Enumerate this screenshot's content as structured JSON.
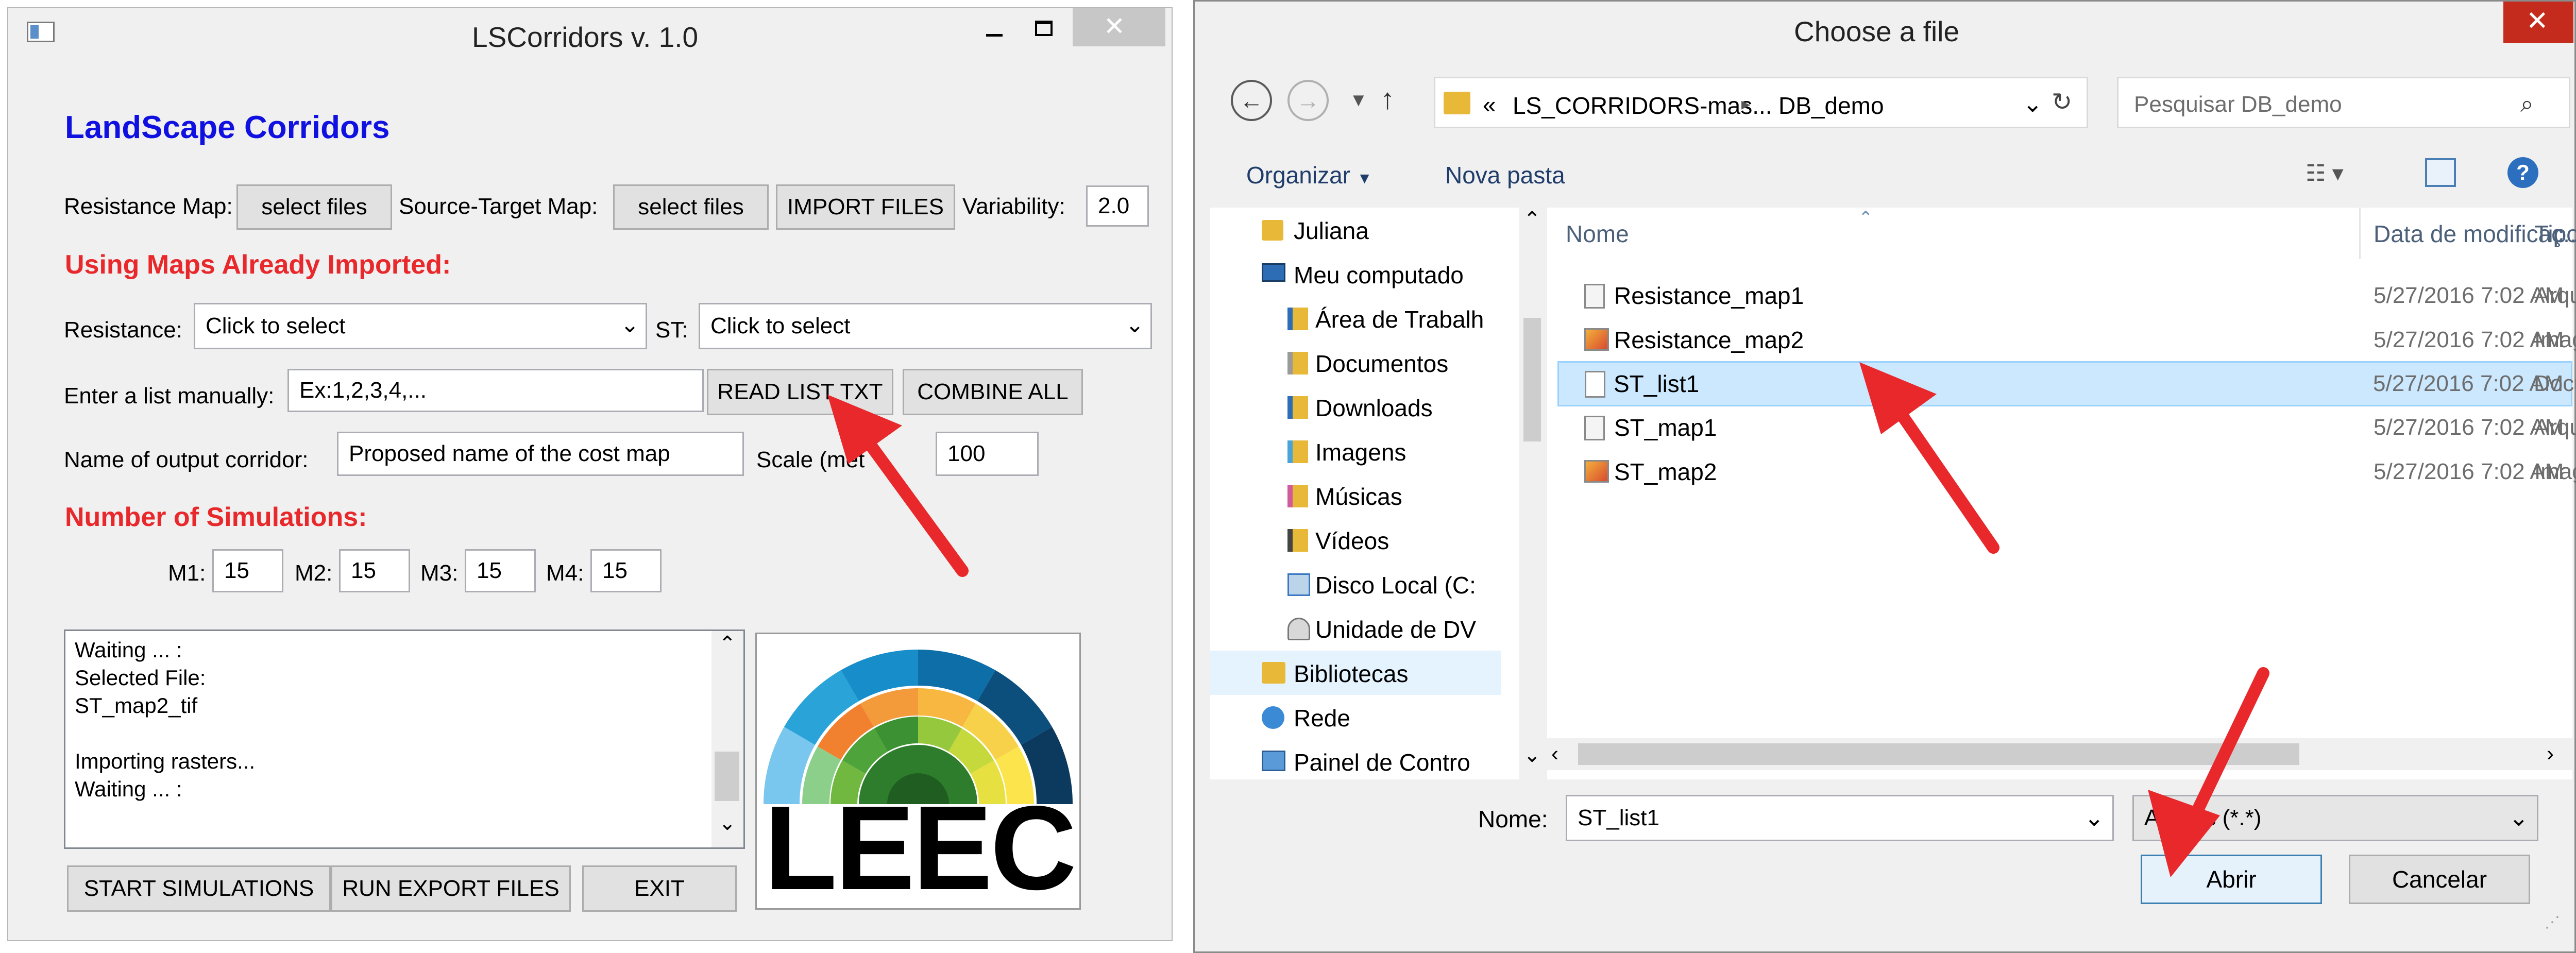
{
  "left_window": {
    "title": "LSCorridors v. 1.0",
    "heading": "LandScape Corridors",
    "resistance_map_label": "Resistance Map:",
    "select_files_1": "select files",
    "source_target_label": "Source-Target Map:",
    "select_files_2": "select files",
    "import_files": "IMPORT FILES",
    "variability_label": "Variability:",
    "variability_value": "2.0",
    "using_maps_heading": "Using Maps Already Imported:",
    "resistance_label": "Resistance:",
    "resistance_select": "Click to select",
    "st_label": "ST:",
    "st_select": "Click to select",
    "enter_list_label": "Enter a list manually:",
    "enter_list_value": "Ex:1,2,3,4,...",
    "read_list_txt": "READ LIST TXT",
    "combine_all": "COMBINE ALL",
    "output_name_label": "Name of output corridor:",
    "output_name_value": "Proposed name of the cost map",
    "scale_label": "Scale (met",
    "scale_value": "100",
    "num_sim_heading": "Number of Simulations:",
    "m1_label": "M1:",
    "m1_value": "15",
    "m2_label": "M2:",
    "m2_value": "15",
    "m3_label": "M3:",
    "m3_value": "15",
    "m4_label": "M4:",
    "m4_value": "15",
    "log_lines": [
      "Waiting ... :",
      "Selected File:",
      "ST_map2_tif",
      "",
      "Importing rasters...",
      "Waiting ... :"
    ],
    "logo_text": "LEEC",
    "start_simulations": "START SIMULATIONS",
    "run_export_files": "RUN EXPORT FILES",
    "exit": "EXIT"
  },
  "file_dialog": {
    "title": "Choose a file",
    "breadcrumb_chevrons": "«",
    "breadcrumb_1": "LS_CORRIDORS-mas...",
    "breadcrumb_sep": "▸",
    "breadcrumb_2": "DB_demo",
    "search_placeholder": "Pesquisar DB_demo",
    "organize": "Organizar",
    "new_folder": "Nova pasta",
    "nav_items": [
      {
        "label": "Juliana",
        "icon": "folder-icon"
      },
      {
        "label": "Meu computado",
        "icon": "computer-icon"
      },
      {
        "label": "Área de Trabalh",
        "icon": "folder-icon"
      },
      {
        "label": "Documentos",
        "icon": "folder-icon"
      },
      {
        "label": "Downloads",
        "icon": "folder-icon"
      },
      {
        "label": "Imagens",
        "icon": "folder-icon"
      },
      {
        "label": "Músicas",
        "icon": "folder-icon"
      },
      {
        "label": "Vídeos",
        "icon": "folder-icon"
      },
      {
        "label": "Disco Local (C:",
        "icon": "drive-icon"
      },
      {
        "label": "Unidade de DV",
        "icon": "drive-icon"
      },
      {
        "label": "Bibliotecas",
        "icon": "folder-icon"
      },
      {
        "label": "Rede",
        "icon": "network-icon"
      },
      {
        "label": "Painel de Contro",
        "icon": "control-panel-icon"
      }
    ],
    "columns": {
      "name": "Nome",
      "date": "Data de modificaç...",
      "type": "Tipo"
    },
    "files": [
      {
        "name": "Resistance_map1",
        "date": "5/27/2016 7:02 AM",
        "type": "Arquivo d",
        "icon": "file-icon"
      },
      {
        "name": "Resistance_map2",
        "date": "5/27/2016 7:02 AM",
        "type": "Imagem T",
        "icon": "image-icon"
      },
      {
        "name": "ST_list1",
        "date": "5/27/2016 7:02 AM",
        "type": "Documen",
        "icon": "text-file-icon"
      },
      {
        "name": "ST_map1",
        "date": "5/27/2016 7:02 AM",
        "type": "Arquivo d",
        "icon": "file-icon"
      },
      {
        "name": "ST_map2",
        "date": "5/27/2016 7:02 AM",
        "type": "Imagem T",
        "icon": "image-icon"
      }
    ],
    "filename_label": "Nome:",
    "filename_value": "ST_list1",
    "filter_value": "All files (*.*)",
    "open_button": "Abrir",
    "cancel_button": "Cancelar"
  },
  "colors": {
    "accent_red": "#e8282b",
    "heading_blue": "#1010e0",
    "selection": "#cce8ff"
  }
}
